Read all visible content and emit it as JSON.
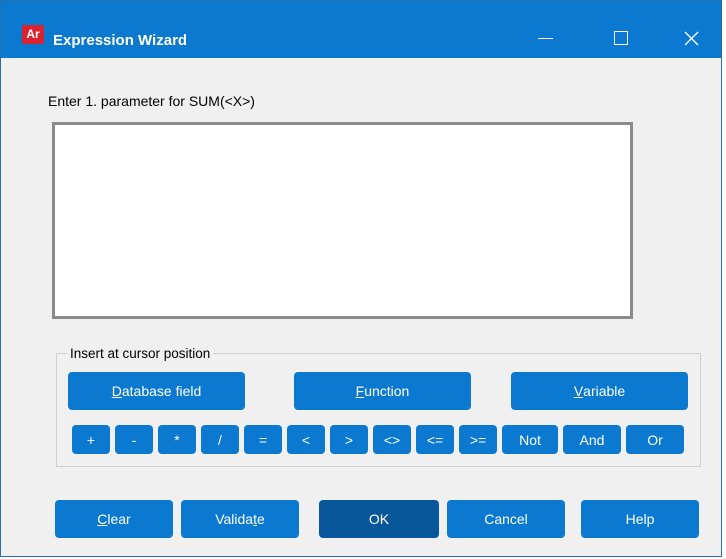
{
  "window": {
    "title": "Expression Wizard",
    "icon_label": "Ar",
    "titlebar_color": "#0b79cf"
  },
  "prompt": "Enter 1. parameter for SUM(<X>)",
  "expression": {
    "value": ""
  },
  "insert_group": {
    "label": "Insert at cursor position",
    "buttons": [
      {
        "pre": "",
        "u": "D",
        "post": "atabase field"
      },
      {
        "pre": "",
        "u": "F",
        "post": "unction"
      },
      {
        "pre": "",
        "u": "V",
        "post": "ariable"
      }
    ],
    "operators": [
      "+",
      "-",
      "*",
      "/",
      "=",
      "<",
      ">",
      "<>",
      "<=",
      ">=",
      "Not",
      "And",
      "Or"
    ]
  },
  "footer": {
    "clear": {
      "pre": "",
      "u": "C",
      "post": "lear"
    },
    "validate": {
      "pre": "Valida",
      "u": "t",
      "post": "e"
    },
    "ok": "OK",
    "cancel": "Cancel",
    "help": "Help"
  }
}
